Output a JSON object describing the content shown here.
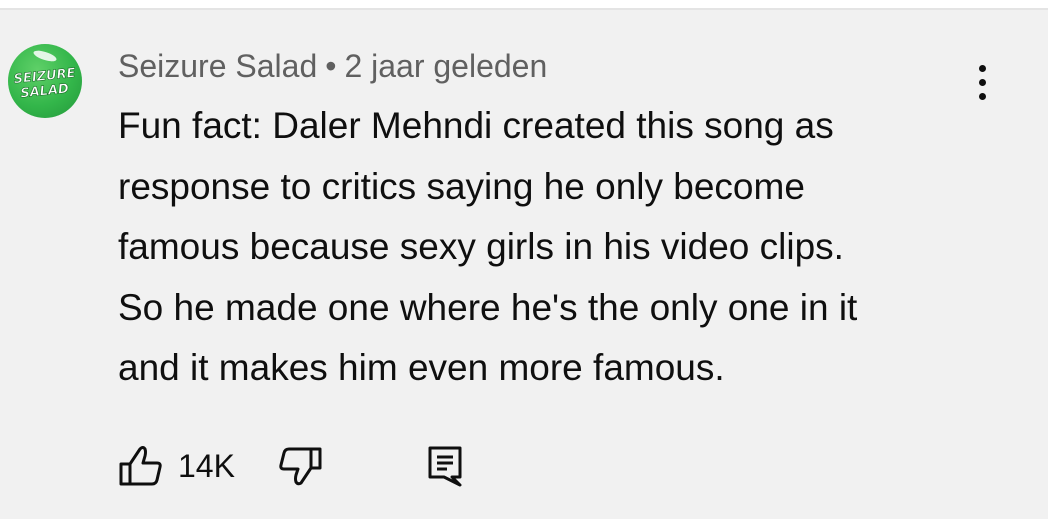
{
  "comment": {
    "author": "Seizure Salad",
    "separator": "•",
    "timestamp": "2 jaar geleden",
    "avatar_text_line1": "SEIZURE",
    "avatar_text_line2": "SALAD",
    "text": "Fun fact: Daler Mehndi created this song as\nresponse to critics saying he only become\nfamous because sexy girls in his video clips.\nSo he made one where he's the only one in it\nand it makes him even more famous.",
    "like_count": "14K"
  },
  "icons": {
    "like": "thumbs-up-icon",
    "dislike": "thumbs-down-icon",
    "reply": "reply-comment-icon",
    "menu": "more-vertical-icon"
  },
  "colors": {
    "background": "#f1f1f1",
    "text": "#0f0f0f",
    "meta_text": "#606060",
    "avatar_green": "#33b64a"
  }
}
